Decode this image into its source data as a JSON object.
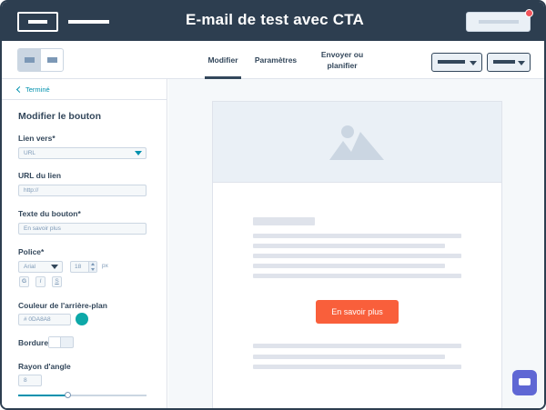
{
  "header": {
    "title": "E-mail de test avec CTA"
  },
  "toolbar": {
    "tabs": [
      {
        "label": "Modifier",
        "active": true
      },
      {
        "label": "Paramètres",
        "active": false
      },
      {
        "label": "Envoyer ou planifier",
        "active": false
      }
    ]
  },
  "panel": {
    "done_label": "Terminé",
    "title": "Modifier le bouton",
    "link_to": {
      "label": "Lien vers*",
      "value": "URL"
    },
    "link_url": {
      "label": "URL du lien",
      "placeholder": "http://"
    },
    "button_text": {
      "label": "Texte du bouton*",
      "value": "En savoir plus"
    },
    "font": {
      "label": "Police*",
      "family": "Arial",
      "size": "18",
      "unit": "px",
      "bold": "G",
      "italic": "I",
      "underline": "S"
    },
    "bg_color": {
      "label": "Couleur de l'arrière-plan",
      "value": "# 0DA8A8",
      "swatch": "#0DA8A8"
    },
    "border": {
      "label": "Bordure",
      "enabled": false
    },
    "corner_radius": {
      "label": "Rayon d'angle",
      "value": "8",
      "slider_fraction": 0.38
    }
  },
  "email": {
    "cta_label": "En savoir plus",
    "cta_color": "#f95f3b"
  },
  "colors": {
    "header_bg": "#2d3e50",
    "accent": "#0091ae",
    "chat_button": "#5f67d4"
  }
}
